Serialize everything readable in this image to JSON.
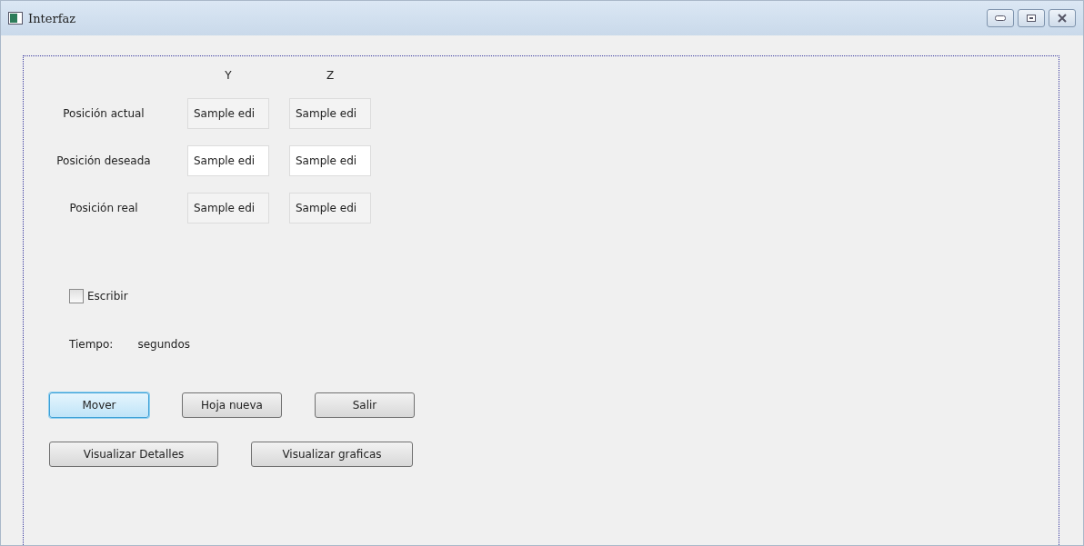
{
  "window": {
    "title": "Interfaz"
  },
  "columns": [
    "Y",
    "Z"
  ],
  "rows": [
    {
      "label": "Posición actual",
      "fields": [
        {
          "value": "Sample edi",
          "disabled": true
        },
        {
          "value": "Sample edi",
          "disabled": true
        }
      ]
    },
    {
      "label": "Posición deseada",
      "fields": [
        {
          "value": "Sample edi",
          "disabled": false
        },
        {
          "value": "Sample edi",
          "disabled": false
        }
      ]
    },
    {
      "label": "Posición real",
      "fields": [
        {
          "value": "Sample edi",
          "disabled": true
        },
        {
          "value": "Sample edi",
          "disabled": true
        }
      ]
    }
  ],
  "checkbox": {
    "label": "Escribir",
    "checked": false
  },
  "time": {
    "label": "Tiempo:",
    "unit": "segundos"
  },
  "button_rows": [
    [
      {
        "label": "Mover",
        "focused": true
      },
      {
        "label": "Hoja nueva",
        "focused": false
      },
      {
        "label": "Salir",
        "focused": false
      }
    ],
    [
      {
        "label": "Visualizar Detalles",
        "focused": false
      },
      {
        "label": "Visualizar graficas",
        "focused": false
      }
    ]
  ]
}
